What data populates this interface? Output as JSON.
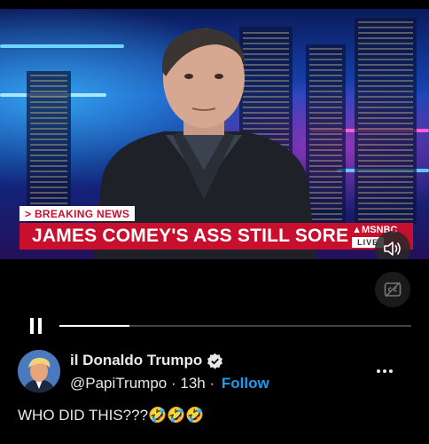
{
  "video": {
    "breaking_label": "> BREAKING NEWS",
    "headline": "JAMES COMEY'S ASS STILL SORE",
    "network": "MSNBC",
    "live_label": "LIVE",
    "progress": 0.2
  },
  "icons": {
    "volume": "speaker-icon",
    "captions": "captions-icon",
    "pause": "pause-icon",
    "more": "more-icon",
    "verified": "verified-badge-icon"
  },
  "post": {
    "display_name": "il Donaldo Trumpo",
    "handle": "@PapiTrumpo",
    "separator": "·",
    "time": "13h",
    "follow_label": "Follow",
    "text": "WHO DID THIS???🤣🤣🤣"
  },
  "colors": {
    "accent": "#1d9bf0",
    "news_red": "#c8102e",
    "background": "#000000"
  }
}
